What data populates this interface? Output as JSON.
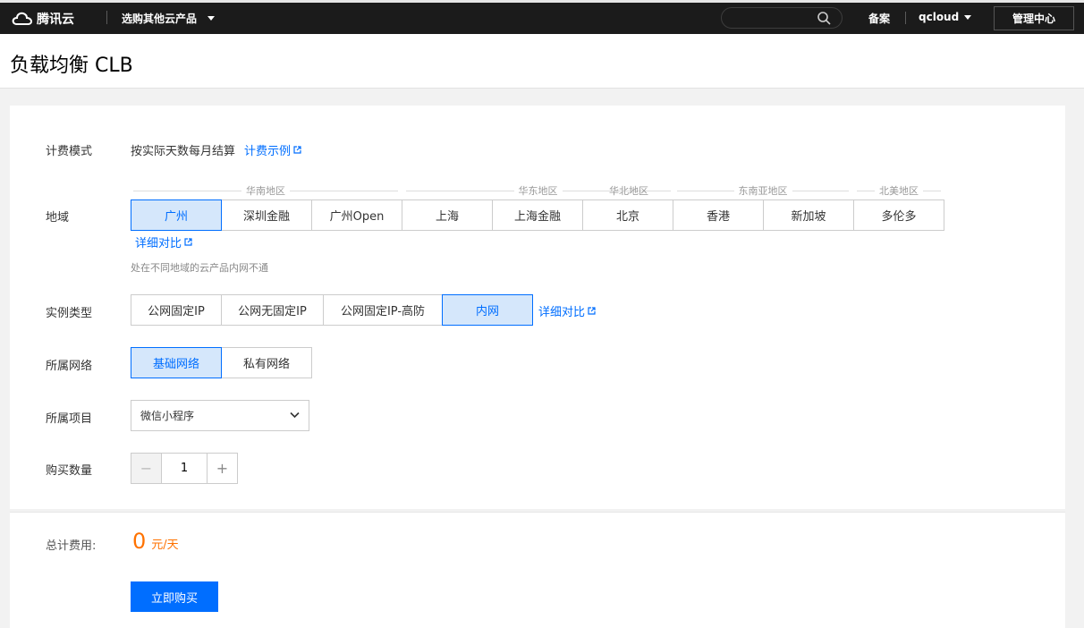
{
  "topbar": {
    "logo_text": "腾讯云",
    "products_label": "选购其他云产品",
    "search_placeholder": "",
    "beian_label": "备案",
    "user_name": "qcloud",
    "console_label": "管理中心"
  },
  "page": {
    "title": "负载均衡 CLB"
  },
  "billing": {
    "label": "计费模式",
    "value": "按实际天数每月结算",
    "example_link": "计费示例"
  },
  "region": {
    "label": "地域",
    "groups": [
      {
        "name": "华南地区"
      },
      {
        "name": "华东地区"
      },
      {
        "name": "华北地区"
      },
      {
        "name": "东南亚地区"
      },
      {
        "name": "北美地区"
      }
    ],
    "options": [
      "广州",
      "深圳金融",
      "广州Open",
      "上海",
      "上海金融",
      "北京",
      "香港",
      "新加坡",
      "多伦多"
    ],
    "selected": "广州",
    "compare_link": "详细对比",
    "hint": "处在不同地域的云产品内网不通"
  },
  "instance_type": {
    "label": "实例类型",
    "options": [
      "公网固定IP",
      "公网无固定IP",
      "公网固定IP-高防",
      "内网"
    ],
    "selected": "内网",
    "compare_link": "详细对比"
  },
  "network": {
    "label": "所属网络",
    "options": [
      "基础网络",
      "私有网络"
    ],
    "selected": "基础网络"
  },
  "project": {
    "label": "所属项目",
    "selected": "微信小程序"
  },
  "quantity": {
    "label": "购买数量",
    "value": "1",
    "minus": "−",
    "plus": "+"
  },
  "total": {
    "label": "总计费用:",
    "amount": "0",
    "unit": "元/天",
    "buy_label": "立即购买"
  },
  "colors": {
    "primary": "#006eff",
    "price": "#ff7200",
    "topbar": "#1b1b1b"
  }
}
